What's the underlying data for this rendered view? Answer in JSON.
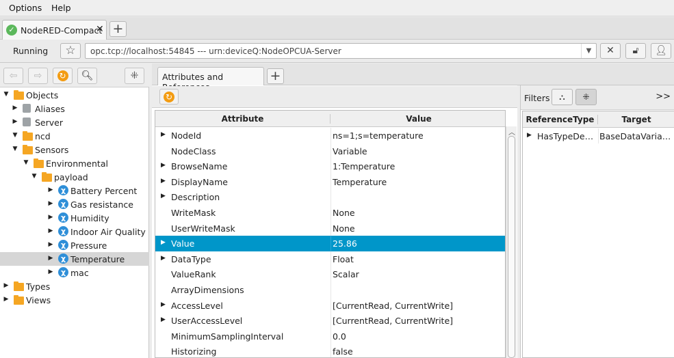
{
  "menu": {
    "items": [
      "Options",
      "Help"
    ]
  },
  "tabs": {
    "connection_label": "NodeRED-Compact",
    "close_glyph": "✕",
    "add_glyph": "+"
  },
  "address": {
    "status": "Running",
    "url": "opc.tcp://localhost:54845 --- urn:deviceQ:NodeOPCUA-Server"
  },
  "tree": {
    "items": [
      {
        "label": "Objects",
        "icon": "folder-icon",
        "expanded": true,
        "level": 0
      },
      {
        "label": "Aliases",
        "icon": "object-icon",
        "expanded": false,
        "level": 1
      },
      {
        "label": "Server",
        "icon": "object-icon",
        "expanded": false,
        "level": 1
      },
      {
        "label": "ncd",
        "icon": "folder-icon",
        "expanded": true,
        "level": 1
      },
      {
        "label": "Sensors",
        "icon": "folder-icon",
        "expanded": true,
        "level": 2
      },
      {
        "label": "Environmental",
        "icon": "folder-icon",
        "expanded": true,
        "level": 3
      },
      {
        "label": "payload",
        "icon": "folder-icon",
        "expanded": true,
        "level": 4
      },
      {
        "label": "Battery Percent",
        "icon": "variable-icon",
        "expanded": false,
        "level": 5
      },
      {
        "label": "Gas resistance",
        "icon": "variable-icon",
        "expanded": false,
        "level": 5
      },
      {
        "label": "Humidity",
        "icon": "variable-icon",
        "expanded": false,
        "level": 5
      },
      {
        "label": "Indoor Air Quality",
        "icon": "variable-icon",
        "expanded": false,
        "level": 5
      },
      {
        "label": "Pressure",
        "icon": "variable-icon",
        "expanded": false,
        "level": 5
      },
      {
        "label": "Temperature",
        "icon": "variable-icon",
        "expanded": false,
        "level": 5,
        "selected": true
      },
      {
        "label": "mac",
        "icon": "variable-icon",
        "expanded": false,
        "level": 5
      },
      {
        "label": "Types",
        "icon": "folder-icon",
        "expanded": false,
        "level": 0
      },
      {
        "label": "Views",
        "icon": "folder-icon",
        "expanded": false,
        "level": 0
      }
    ]
  },
  "attributes": {
    "tab_label": "Attributes and References",
    "headers": [
      "Attribute",
      "Value"
    ],
    "rows": [
      {
        "attribute": "NodeId",
        "value": "ns=1;s=temperature",
        "expandable": true
      },
      {
        "attribute": "NodeClass",
        "value": "Variable",
        "expandable": false
      },
      {
        "attribute": "BrowseName",
        "value": "1:Temperature",
        "expandable": true
      },
      {
        "attribute": "DisplayName",
        "value": "Temperature",
        "expandable": true
      },
      {
        "attribute": "Description",
        "value": "",
        "expandable": true
      },
      {
        "attribute": "WriteMask",
        "value": "None",
        "expandable": false
      },
      {
        "attribute": "UserWriteMask",
        "value": "None",
        "expandable": false
      },
      {
        "attribute": "Value",
        "value": "25.86",
        "expandable": true,
        "selected": true
      },
      {
        "attribute": "DataType",
        "value": "Float",
        "expandable": true
      },
      {
        "attribute": "ValueRank",
        "value": "Scalar",
        "expandable": false
      },
      {
        "attribute": "ArrayDimensions",
        "value": "",
        "expandable": false
      },
      {
        "attribute": "AccessLevel",
        "value": "[CurrentRead, CurrentWrite]",
        "expandable": true
      },
      {
        "attribute": "UserAccessLevel",
        "value": "[CurrentRead, CurrentWrite]",
        "expandable": true
      },
      {
        "attribute": "MinimumSamplingInterval",
        "value": "0.0",
        "expandable": false
      },
      {
        "attribute": "Historizing",
        "value": "false",
        "expandable": false
      }
    ]
  },
  "references": {
    "filters_label": "Filters",
    "headers": [
      "ReferenceType",
      "Target"
    ],
    "rows": [
      {
        "reference_type": "HasTypeDefinition",
        "target": "BaseDataVariableType"
      }
    ]
  },
  "colors": {
    "selection": "#0096c9",
    "folder": "#f5a623",
    "variable": "#2f8fd8",
    "refresh": "#f39c12",
    "connected": "#5cb85c"
  }
}
